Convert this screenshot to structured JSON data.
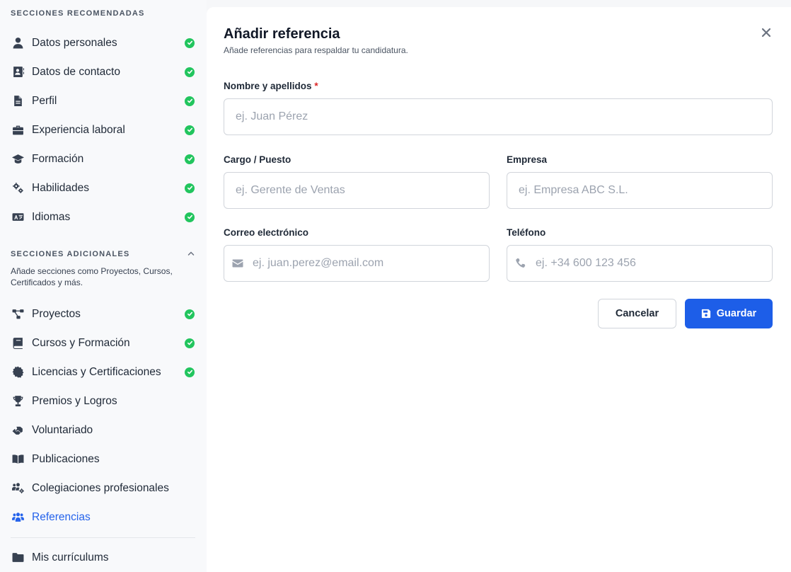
{
  "sidebar": {
    "recommended_title": "SECCIONES RECOMENDADAS",
    "recommended": [
      {
        "label": "Datos personales",
        "icon": "user-icon",
        "done": true
      },
      {
        "label": "Datos de contacto",
        "icon": "contact-card-icon",
        "done": true
      },
      {
        "label": "Perfil",
        "icon": "document-icon",
        "done": true
      },
      {
        "label": "Experiencia laboral",
        "icon": "briefcase-icon",
        "done": true
      },
      {
        "label": "Formación",
        "icon": "graduation-cap-icon",
        "done": true
      },
      {
        "label": "Habilidades",
        "icon": "gears-icon",
        "done": true
      },
      {
        "label": "Idiomas",
        "icon": "language-icon",
        "done": true
      }
    ],
    "additional_title": "SECCIONES ADICIONALES",
    "additional_desc": "Añade secciones como Proyectos, Cursos, Certificados y más.",
    "additional": [
      {
        "label": "Proyectos",
        "icon": "project-diagram-icon",
        "done": true
      },
      {
        "label": "Cursos y Formación",
        "icon": "book-icon",
        "done": true
      },
      {
        "label": "Licencias y Certificaciones",
        "icon": "certificate-icon",
        "done": true
      },
      {
        "label": "Premios y Logros",
        "icon": "trophy-icon",
        "done": false
      },
      {
        "label": "Voluntariado",
        "icon": "hands-helping-icon",
        "done": false
      },
      {
        "label": "Publicaciones",
        "icon": "book-open-icon",
        "done": false
      },
      {
        "label": "Colegiaciones profesionales",
        "icon": "users-cog-icon",
        "done": false
      },
      {
        "label": "Referencias",
        "icon": "users-icon",
        "done": false,
        "active": true
      }
    ],
    "bottom_item": {
      "label": "Mis currículums",
      "icon": "folder-icon"
    }
  },
  "modal": {
    "title": "Añadir referencia",
    "subtitle": "Añade referencias para respaldar tu candidatura.",
    "fields": {
      "name": {
        "label": "Nombre y apellidos",
        "required_mark": "*",
        "placeholder": "ej. Juan Pérez",
        "value": ""
      },
      "position": {
        "label": "Cargo / Puesto",
        "placeholder": "ej. Gerente de Ventas",
        "value": ""
      },
      "company": {
        "label": "Empresa",
        "placeholder": "ej. Empresa ABC S.L.",
        "value": ""
      },
      "email": {
        "label": "Correo electrónico",
        "placeholder": "ej. juan.perez@email.com",
        "value": ""
      },
      "phone": {
        "label": "Teléfono",
        "placeholder": "ej. +34 600 123 456",
        "value": ""
      }
    },
    "cancel_label": "Cancelar",
    "save_label": "Guardar"
  },
  "colors": {
    "accent": "#1d5ee8",
    "active_link": "#2563eb",
    "success": "#22c55e",
    "required": "#dc2626"
  }
}
